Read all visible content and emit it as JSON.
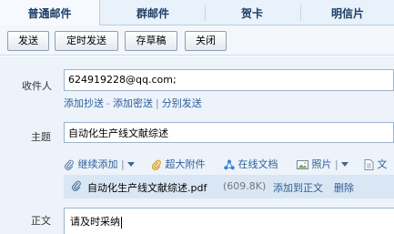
{
  "tabs": [
    {
      "label": "普通邮件",
      "active": true
    },
    {
      "label": "群邮件",
      "active": false
    },
    {
      "label": "贺卡",
      "active": false
    },
    {
      "label": "明信片",
      "active": false
    }
  ],
  "toolbar": {
    "send": "发送",
    "scheduled_send": "定时发送",
    "save_draft": "存草稿",
    "close": "关闭"
  },
  "recipient": {
    "label": "收件人",
    "value": "624919228@qq.com;",
    "add_cc": "添加抄送",
    "add_bcc": "添加密送",
    "separate_send": "分别发送",
    "dash": "-",
    "sep": "|"
  },
  "subject": {
    "label": "主题",
    "value": "自动化生产线文献综述"
  },
  "attachments": {
    "continue_add": "继续添加",
    "large_attachment": "超大附件",
    "online_doc": "在线文档",
    "photo": "照片",
    "doc": "文"
  },
  "file": {
    "name": "自动化生产线文献综述.pdf",
    "size": "(609.8K)",
    "add_to_body": "添加到正文",
    "delete": "删除"
  },
  "body": {
    "label": "正文",
    "value": "请及时采纳"
  },
  "colors": {
    "link": "#2d5f9a",
    "tab_bg": "#e9f1fa",
    "compose_bg": "#edf3fa",
    "file_row_bg": "#d9e6f4"
  }
}
